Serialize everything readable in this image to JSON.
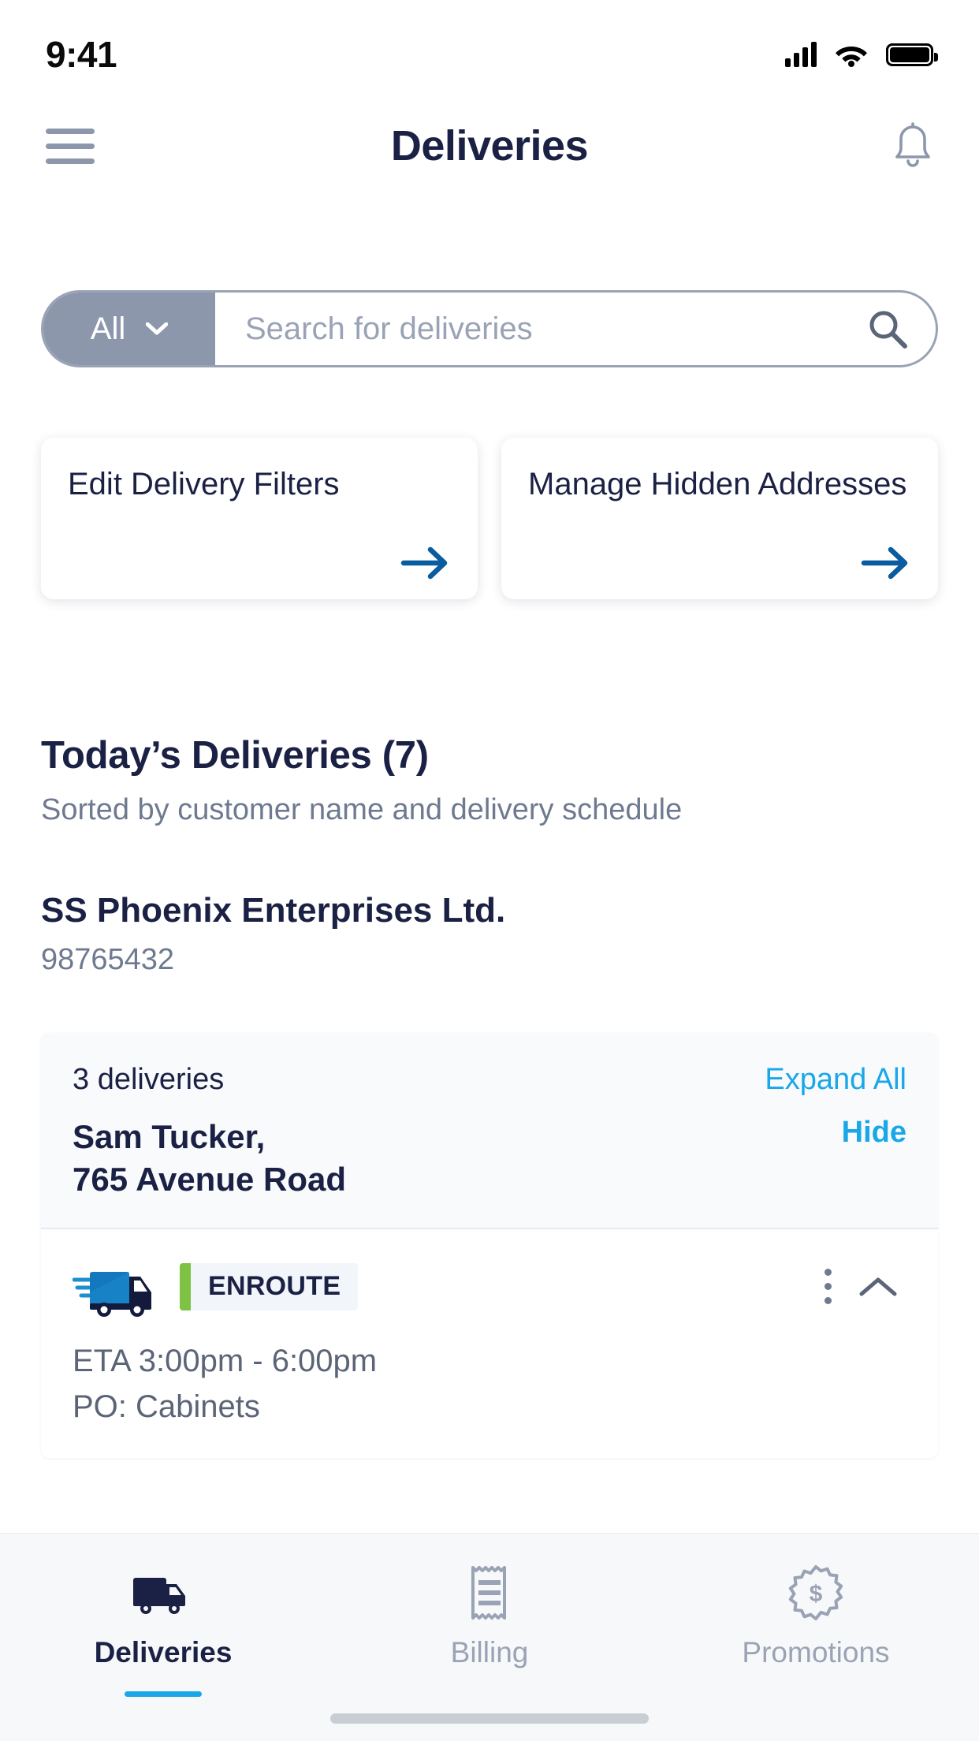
{
  "status_bar": {
    "time": "9:41",
    "signal_icon": "cellular-signal-icon",
    "wifi_icon": "wifi-icon",
    "battery_icon": "battery-full-icon"
  },
  "header": {
    "menu_icon": "hamburger-menu-icon",
    "title": "Deliveries",
    "notifications_icon": "bell-icon"
  },
  "search": {
    "filter_label": "All",
    "filter_chevron_icon": "chevron-down-icon",
    "placeholder": "Search for deliveries",
    "search_icon": "search-icon"
  },
  "action_cards": [
    {
      "title": "Edit Delivery Filters",
      "arrow_icon": "arrow-right-icon"
    },
    {
      "title": "Manage Hidden Addresses",
      "arrow_icon": "arrow-right-icon"
    }
  ],
  "section": {
    "heading": "Today’s Deliveries (7)",
    "subheading": "Sorted by customer name and delivery schedule"
  },
  "customer": {
    "name": "SS Phoenix Enterprises Ltd.",
    "account_number": "98765432"
  },
  "delivery_group": {
    "count_label": "3 deliveries",
    "expand_all_label": "Expand All",
    "recipient_name": "Sam Tucker,",
    "address": "765 Avenue Road",
    "hide_label": "Hide",
    "deliveries": [
      {
        "truck_icon": "delivery-truck-icon",
        "status": "ENROUTE",
        "status_color": "#7DC242",
        "more_icon": "more-vertical-icon",
        "collapse_icon": "chevron-up-icon",
        "eta": "ETA 3:00pm - 6:00pm",
        "po": "PO: Cabinets"
      }
    ]
  },
  "bottom_nav": {
    "items": [
      {
        "label": "Deliveries",
        "icon": "truck-icon",
        "active": true
      },
      {
        "label": "Billing",
        "icon": "receipt-icon",
        "active": false
      },
      {
        "label": "Promotions",
        "icon": "dollar-badge-icon",
        "active": false
      }
    ]
  },
  "colors": {
    "navy": "#1B2144",
    "accent_blue": "#19A7E8",
    "link_blue": "#0A5C9E",
    "muted": "#6F7A90",
    "pill_gray": "#8D97AC",
    "green": "#7DC242"
  }
}
